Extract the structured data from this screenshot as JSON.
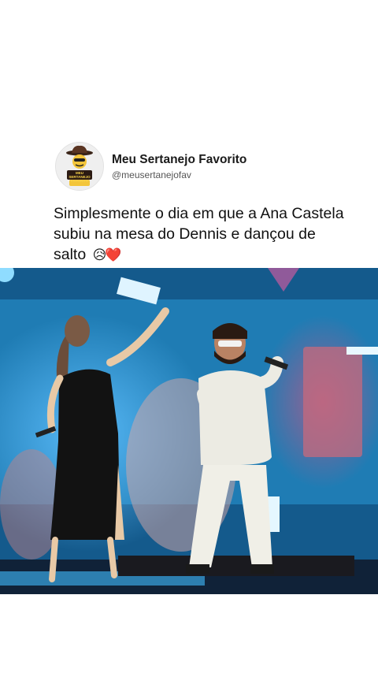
{
  "post": {
    "account": {
      "display_name": "Meu Sertanejo Favorito",
      "handle": "@meusertanejofav",
      "avatar_text": "MEU SERTANEJO FAVORITO"
    },
    "caption": "Simplesmente o dia em que a Ana Castela subiu na mesa do Dennis e dançou de salto",
    "caption_emojis": "😥❤️",
    "media": {
      "type": "video-still",
      "icon": "concert-photo"
    }
  },
  "colors": {
    "background": "#ffffff",
    "name_text": "#1a1a1a",
    "handle_text": "#555555",
    "stage_blue": "#1b78ad"
  }
}
